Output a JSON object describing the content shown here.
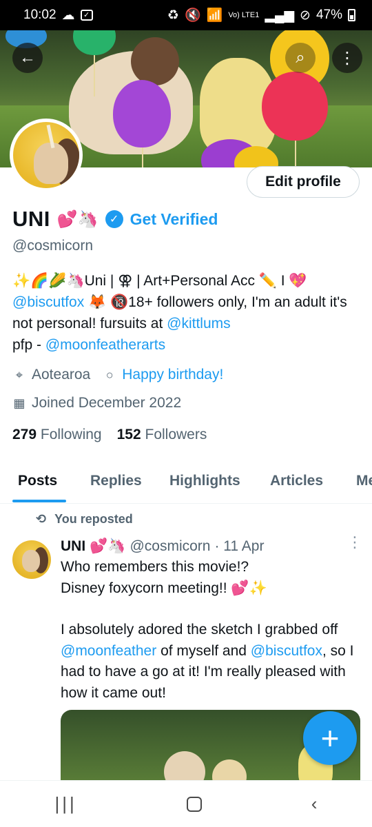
{
  "status_bar": {
    "time": "10:02",
    "volte": "Vo)\nLTE1",
    "battery": "47%"
  },
  "profile": {
    "display_name": "UNI",
    "name_emoji": "💕🦄",
    "get_verified": "Get Verified",
    "handle": "@cosmicorn",
    "edit_profile": "Edit profile",
    "bio": {
      "line1": "✨🌈🌽🦄Uni | ⚢ | Art+Personal Acc ✏️ I 💖",
      "mention1": "@biscutfox",
      "line2_rest": " 🦊 🔞18+ followers only, I'm an adult it's not personal!  fursuits at ",
      "mention2": "@kittlums",
      "line3_pre": "pfp - ",
      "mention3": "@moonfeatherarts"
    },
    "location": "Aotearoa",
    "birthday": "Happy birthday!",
    "joined": "Joined December 2022",
    "following_count": "279",
    "following_label": "Following",
    "followers_count": "152",
    "followers_label": "Followers"
  },
  "tabs": [
    "Posts",
    "Replies",
    "Highlights",
    "Articles",
    "Me"
  ],
  "post": {
    "repost_label": "You reposted",
    "author_name": "UNI",
    "author_emoji": "💕🦄",
    "author_handle": "@cosmicorn",
    "date": "· 11 Apr",
    "line1": "Who remembers this movie!?",
    "line2": "Disney foxycorn meeting!! 💕✨",
    "line3_pre": "I absolutely adored the sketch I grabbed off ",
    "mention1": "@moonfeather",
    "line3_mid": " of myself and ",
    "mention2": "@biscutfox",
    "line3_post": ", so I had to have a go at it! I'm really pleased with how it came out!"
  },
  "colors": {
    "accent": "#1d9bf0",
    "text_primary": "#0f1419",
    "text_secondary": "#536471"
  },
  "icons": {
    "back": "arrow-left-icon",
    "search": "search-icon",
    "more": "more-vertical-icon",
    "verified": "verified-badge-icon",
    "location": "location-pin-icon",
    "birthday": "balloon-icon",
    "calendar": "calendar-icon",
    "repost": "repost-icon",
    "compose": "plus-icon"
  }
}
